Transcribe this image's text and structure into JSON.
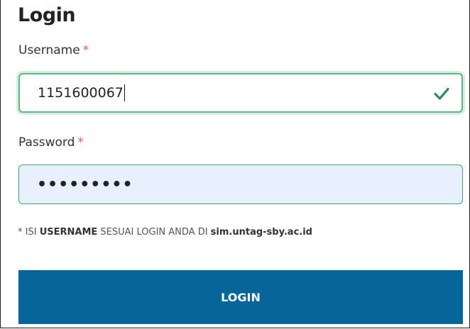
{
  "form": {
    "title": "Login",
    "username": {
      "label": "Username",
      "required_mark": "*",
      "value": "1151600067",
      "valid_icon": "check-icon"
    },
    "password": {
      "label": "Password",
      "required_mark": "*",
      "value_masked": "•••••••••"
    },
    "hint": {
      "prefix": "* ISI ",
      "emphasis": "USERNAME",
      "middle": " SESUAI LOGIN ANDA DI ",
      "site": "sim.untag-sby.ac.id"
    },
    "submit_label": "LOGIN"
  },
  "colors": {
    "valid_border": "#5bb784",
    "required": "#e35d5d",
    "button": "#07659a",
    "password_bg": "#e8f0fe"
  }
}
